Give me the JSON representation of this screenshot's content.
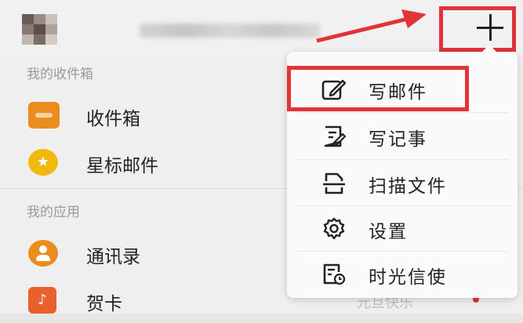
{
  "sections": {
    "inbox_header": "我的收件箱",
    "apps_header": "我的应用"
  },
  "inbox_items": [
    {
      "label": "收件箱",
      "icon": "inbox-tray-icon"
    },
    {
      "label": "星标邮件",
      "icon": "star-icon"
    }
  ],
  "app_items": [
    {
      "label": "通讯录",
      "icon": "contacts-icon"
    },
    {
      "label": "贺卡",
      "icon": "greeting-card-icon",
      "trailing": "元旦快乐"
    }
  ],
  "menu": {
    "items": [
      {
        "label": "写邮件",
        "icon": "compose-edit-icon"
      },
      {
        "label": "写记事",
        "icon": "note-icon"
      },
      {
        "label": "扫描文件",
        "icon": "scan-document-icon"
      },
      {
        "label": "设置",
        "icon": "gear-icon"
      },
      {
        "label": "时光信使",
        "icon": "time-letter-icon"
      }
    ]
  },
  "colors": {
    "accent_red": "#e2333b",
    "icon_orange": "#eb8c1e"
  }
}
